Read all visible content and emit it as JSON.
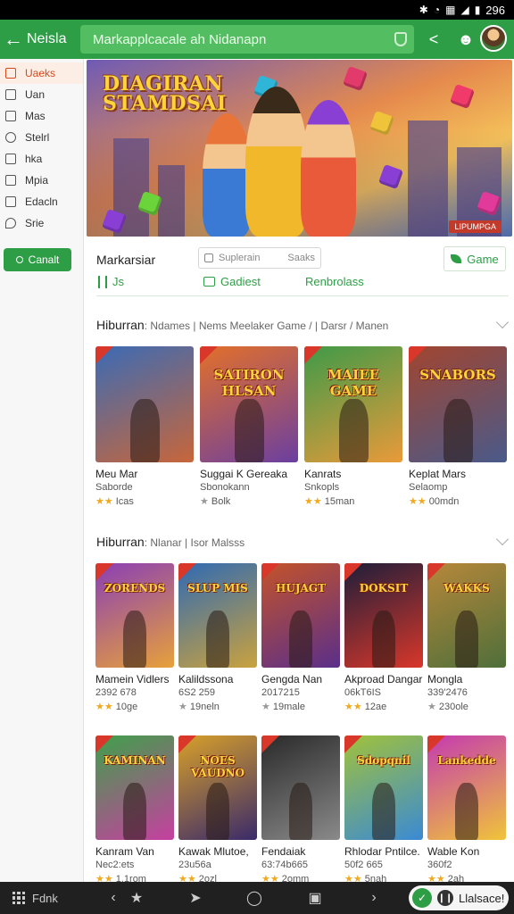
{
  "status_bar": {
    "time": "296"
  },
  "app_bar": {
    "title": "Neisla",
    "search_placeholder": "Markapplcacale ah Nidanapn"
  },
  "sidebar": {
    "items": [
      {
        "label": "Uaeks",
        "icon": "home-icon",
        "active": true
      },
      {
        "label": "Uan",
        "icon": "grid-icon"
      },
      {
        "label": "Mas",
        "icon": "tv-icon"
      },
      {
        "label": "Stelrl",
        "icon": "search-icon"
      },
      {
        "label": "hka",
        "icon": "chart-icon"
      },
      {
        "label": "Mpia",
        "icon": "gear-icon"
      },
      {
        "label": "Edacln",
        "icon": "share-icon"
      },
      {
        "label": "Srie",
        "icon": "location-icon"
      }
    ],
    "button_label": "Canalt"
  },
  "banner": {
    "title_line1": "DIAGIRAN",
    "title_line2": "STAMDSAI",
    "tag": "LIPUMPGA"
  },
  "market": {
    "title": "Markarsiar",
    "search_text": "Suplerain",
    "search_hint": "Saaks",
    "game_button": "Game",
    "tabs": [
      "Js",
      "Gadiest",
      "Renbrolass"
    ]
  },
  "section1": {
    "title": "Hiburran",
    "subtitle": ": Ndames | Nems Meelaker Game / | Darsr / Manen",
    "cards": [
      {
        "title": "Meu Mar",
        "sub": "Saborde",
        "rating": "Icas",
        "thumb_text": "",
        "color1": "#3b6bb5",
        "color2": "#c8663a"
      },
      {
        "title": "Suggai K Gereaka",
        "sub": "Sbonokann",
        "rating": "Bolk",
        "thumb_text": "SATIRON HLSAN",
        "color1": "#e3702a",
        "color2": "#6b3fa0",
        "star_grey": true
      },
      {
        "title": "Kanrats",
        "sub": "Snkopls",
        "rating": "15man",
        "thumb_text": "MAIEE GAME",
        "color1": "#3f9a48",
        "color2": "#e99a3a"
      },
      {
        "title": "Keplat Mars",
        "sub": "Selaomp",
        "rating": "00mdn",
        "thumb_text": "SNABORS",
        "color1": "#a1452f",
        "color2": "#4a5a8a"
      }
    ]
  },
  "section2": {
    "title": "Hiburran",
    "subtitle": ": Nlanar | Isor Malsss",
    "row1": [
      {
        "title": "Mamein Vidlers",
        "sub": "2392 678",
        "rating": "10ge",
        "thumb_text": "ZORENDS",
        "color1": "#8a3fb5",
        "color2": "#e7a13a"
      },
      {
        "title": "Kalildssona",
        "sub": "6S2 259",
        "rating": "19neln",
        "thumb_text": "SLUP MIS",
        "color1": "#2f6ab3",
        "color2": "#caa23e",
        "star_grey": true
      },
      {
        "title": "Gengda Nan",
        "sub": "2017215",
        "rating": "19male",
        "thumb_text": "HUJAGT",
        "color1": "#c4532a",
        "color2": "#5a2f8a",
        "star_grey": true
      },
      {
        "title": "Akproad Dangar",
        "sub": "06kT6IS",
        "rating": "12ae",
        "thumb_text": "DOKSIT",
        "color1": "#1e1e3a",
        "color2": "#d8372a"
      },
      {
        "title": "Mongla",
        "sub": "339'2476",
        "rating": "230ole",
        "thumb_text": "WAKKS",
        "color1": "#b6873a",
        "color2": "#4f6f3a",
        "star_grey": true
      }
    ],
    "row2": [
      {
        "title": "Kanram Van",
        "sub": "Nec2:ets",
        "rating": "1.1rom",
        "thumb_text": "KAMINAN",
        "color1": "#3fa04a",
        "color2": "#c63fa0"
      },
      {
        "title": "Kawak Mlutoe,",
        "sub": "23u56a",
        "rating": "2ozl",
        "thumb_text": "NOES VAUDNO",
        "color1": "#d8a02a",
        "color2": "#3a2a6a"
      },
      {
        "title": "Fendaiak",
        "sub": "63:74b665",
        "rating": "2omm",
        "thumb_text": "",
        "color1": "#2a2a2a",
        "color2": "#8a8a8a"
      },
      {
        "title": "Rhlodar Pntilce.",
        "sub": "50f2 665",
        "rating": "5nah",
        "thumb_text": "Sdopqnil",
        "color1": "#a1c23a",
        "color2": "#3a8ad4"
      },
      {
        "title": "Wable Kon",
        "sub": "360f2",
        "rating": "2ah",
        "thumb_text": "Lankedde",
        "color1": "#c43ab0",
        "color2": "#f0c43a"
      }
    ]
  },
  "bottom_nav": {
    "label": "Fdnk",
    "pill_label": "Llalsace!"
  }
}
